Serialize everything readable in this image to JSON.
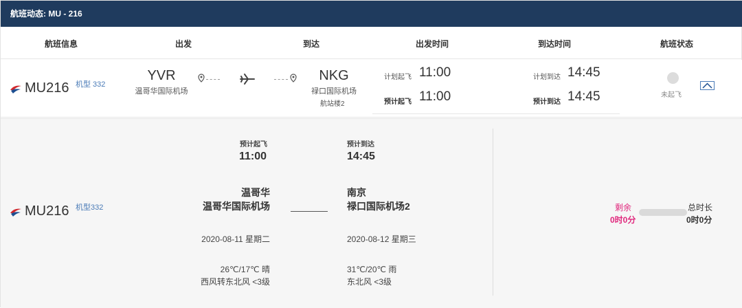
{
  "title": "航班动态: MU - 216",
  "columns": [
    "航班信息",
    "出发",
    "到达",
    "出发时间",
    "到达时间",
    "航班状态"
  ],
  "flight": {
    "number": "MU216",
    "aircraft": "机型 332",
    "aircraft_detail": "机型332",
    "departure": {
      "code": "YVR",
      "airport": "温哥华国际机场"
    },
    "arrival": {
      "code": "NKG",
      "airport": "禄口国际机场",
      "terminal": "航站楼2"
    },
    "dep_time": {
      "planned_label": "计划起飞",
      "planned": "11:00",
      "estimated_label": "预计起飞",
      "estimated": "11:00"
    },
    "arr_time": {
      "planned_label": "计划到达",
      "planned": "14:45",
      "estimated_label": "预计到达",
      "estimated": "14:45"
    },
    "status": "未起飞"
  },
  "detail": {
    "dep": {
      "label": "预计起飞",
      "time": "11:00",
      "city": "温哥华",
      "airport": "温哥华国际机场",
      "date": "2020-08-11 星期二",
      "weather": "26℃/17℃ 晴",
      "wind": "西风转东北风 <3级"
    },
    "arr": {
      "label": "预计到达",
      "time": "14:45",
      "city": "南京",
      "airport": "禄口国际机场2",
      "date": "2020-08-12 星期三",
      "weather": "31℃/20℃ 雨",
      "wind": "东北风 <3级"
    },
    "remaining_label": "剩余",
    "remaining": "0时0分",
    "total_label": "总时长",
    "total": "0时0分",
    "progress": 0
  },
  "colors": {
    "header_bg": "#1f3b5e",
    "accent": "#e0287d",
    "link": "#4a7bb7",
    "logo_red": "#d0282e",
    "logo_blue": "#1d4f91"
  },
  "icons": {
    "logo": "china-eastern-logo",
    "pin": "location-pin-icon",
    "plane": "airplane-icon",
    "collapse": "chevron-up-icon"
  }
}
